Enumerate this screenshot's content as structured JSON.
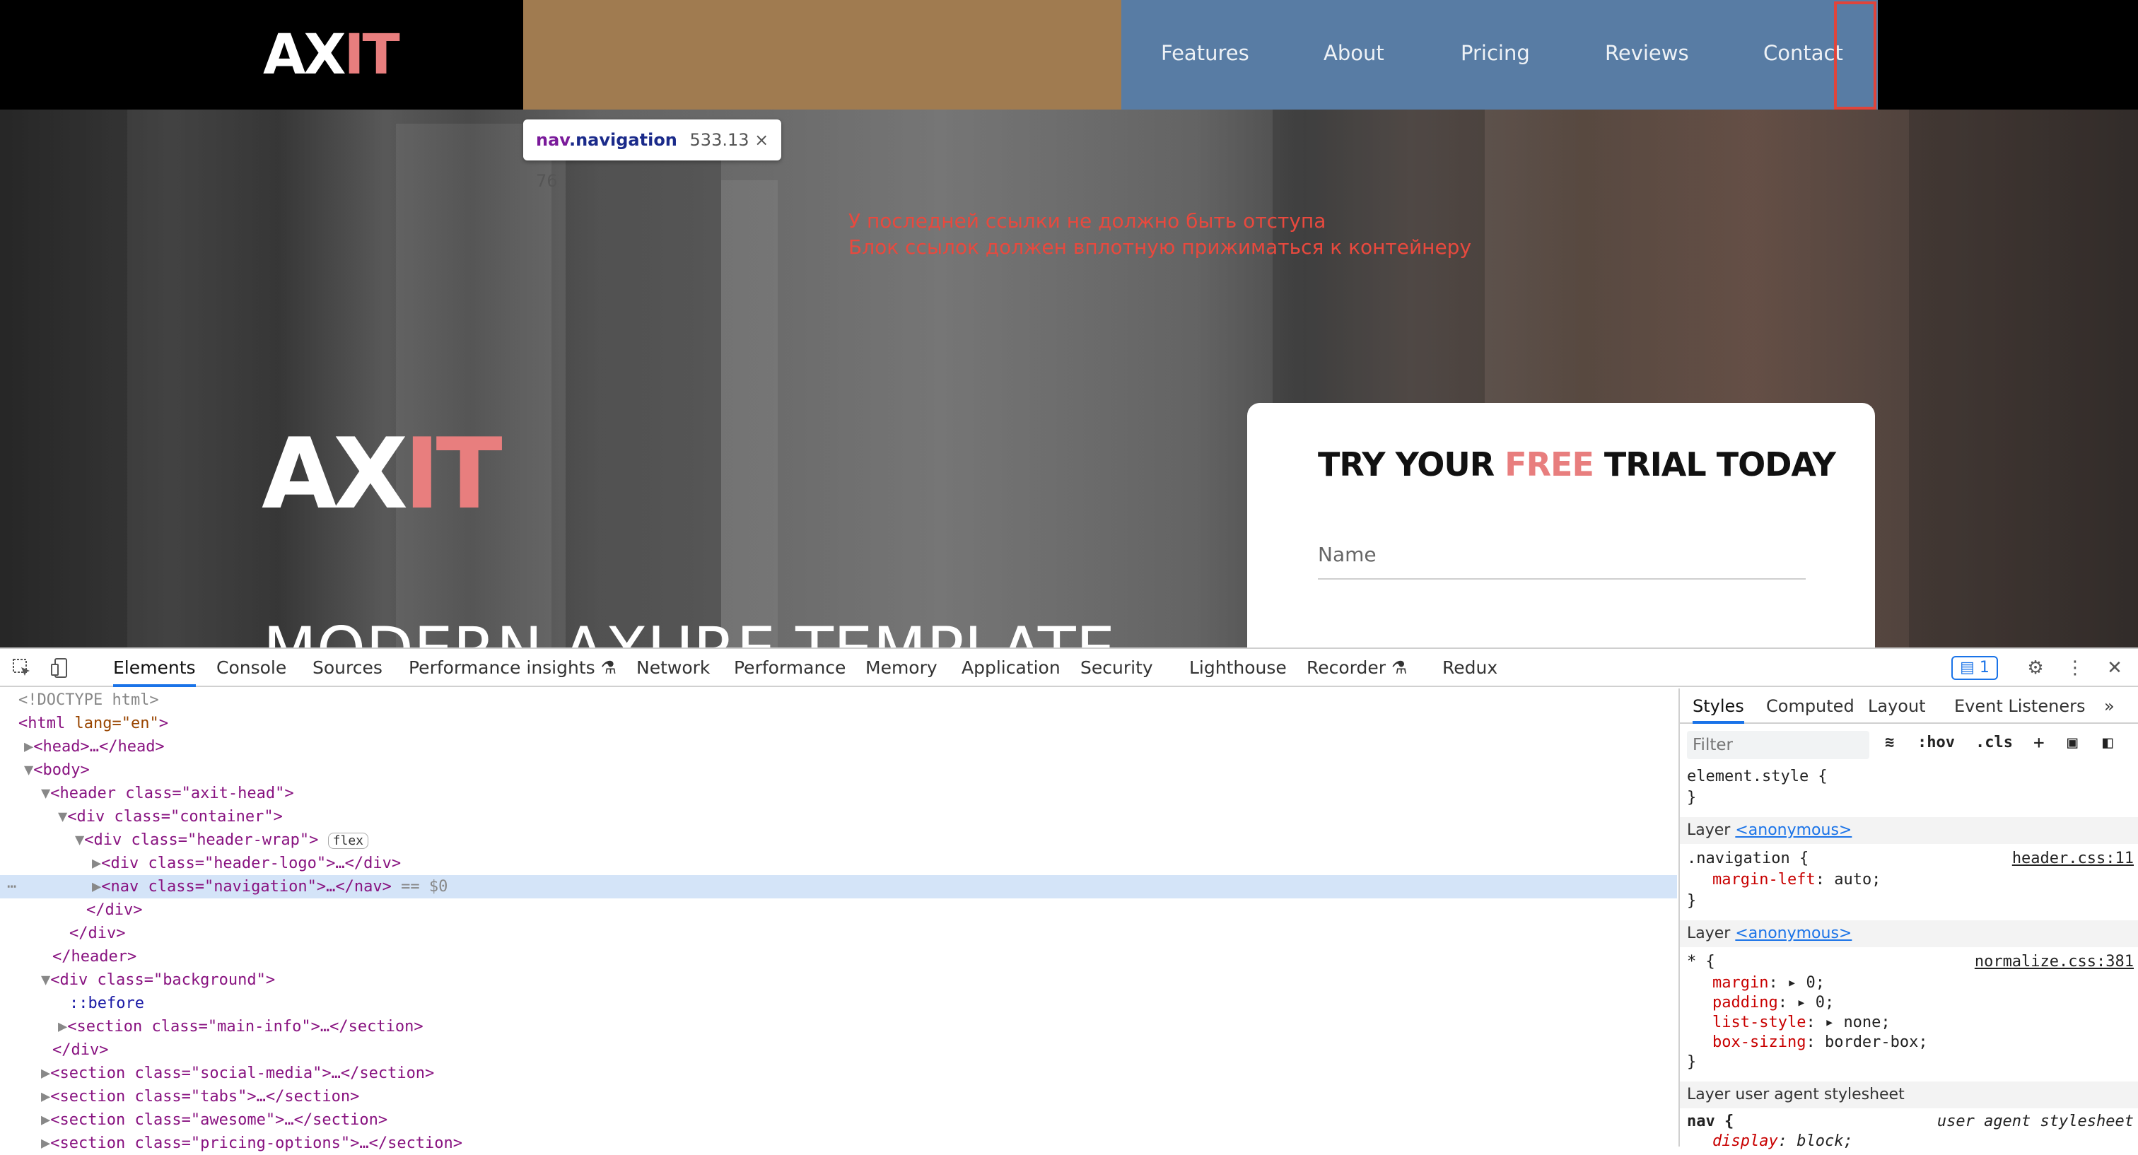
{
  "site": {
    "logo": {
      "part1": "AX",
      "part2": "IT"
    },
    "nav_links": [
      "Features",
      "About",
      "Pricing",
      "Reviews",
      "Contact"
    ],
    "tooltip": {
      "tag": "nav",
      "cls": ".navigation",
      "size": "533.13 × 76"
    },
    "notes": [
      "У последней ссылки не должно быть отступа",
      "Блок ссылок должен вплотную прижиматься к контейнеру"
    ],
    "hero_logo": {
      "part1": "AX",
      "part2": "IT"
    },
    "hero_title": "MODERN AXURE TEMPLATE",
    "form": {
      "title_1": "TRY YOUR ",
      "title_accent": "FREE",
      "title_2": " TRIAL TODAY",
      "name_placeholder": "Name"
    },
    "colors": {
      "accent": "#e87e7e",
      "nav_highlight": "#587ca4",
      "margin_highlight": "#a07b50",
      "selection": "#e0443b"
    }
  },
  "devtools": {
    "tabs": [
      "Elements",
      "Console",
      "Sources",
      "Performance insights",
      "Network",
      "Performance",
      "Memory",
      "Application",
      "Security",
      "Lighthouse",
      "Recorder",
      "Redux"
    ],
    "issues_count": "1",
    "dom": [
      {
        "text": "<!DOCTYPE html>"
      },
      {
        "tag": "html",
        "attrs": "lang=\"en\""
      },
      {
        "text": "<head>…</head>"
      },
      {
        "text": "<body>"
      },
      {
        "text": "<header class=\"axit-head\">"
      },
      {
        "text": "<div class=\"container\">"
      },
      {
        "text": "<div class=\"header-wrap\">",
        "badge": "flex"
      },
      {
        "text": "<div class=\"header-logo\">…</div>"
      },
      {
        "text": "<nav class=\"navigation\">…</nav>",
        "suffix": "== $0"
      },
      {
        "text": "</div>"
      },
      {
        "text": "</div>"
      },
      {
        "text": "</header>"
      },
      {
        "text": "<div class=\"background\">"
      },
      {
        "text": "::before"
      },
      {
        "text": "<section class=\"main-info\">…</section>"
      },
      {
        "text": "</div>"
      },
      {
        "text": "<section class=\"social-media\">…</section>"
      },
      {
        "text": "<section class=\"tabs\">…</section>"
      },
      {
        "text": "<section class=\"awesome\">…</section>"
      },
      {
        "text": "<section class=\"pricing-options\">…</section>"
      }
    ],
    "styles": {
      "tabs": [
        "Styles",
        "Computed",
        "Layout",
        "Event Listeners"
      ],
      "filter_placeholder": "Filter",
      "hov": ":hov",
      "cls": ".cls",
      "element_style": "element.style {",
      "close": "}",
      "layer1": "Layer",
      "anon": "<anonymous>",
      "rule1_sel": ".navigation {",
      "rule1_src": "header.css:11",
      "rule1_prop": "margin-left",
      "rule1_val": "auto;",
      "rule2_sel": "* {",
      "rule2_src": "normalize.css:381",
      "rule2_props": [
        [
          "margin",
          "0;"
        ],
        [
          "padding",
          "0;"
        ],
        [
          "list-style",
          "none;"
        ],
        [
          "box-sizing",
          "border-box;"
        ]
      ],
      "layer_ua": "Layer user agent stylesheet",
      "ua_sel": "nav {",
      "ua_src": "user agent stylesheet",
      "ua_prop": "display",
      "ua_val": "block;"
    }
  }
}
